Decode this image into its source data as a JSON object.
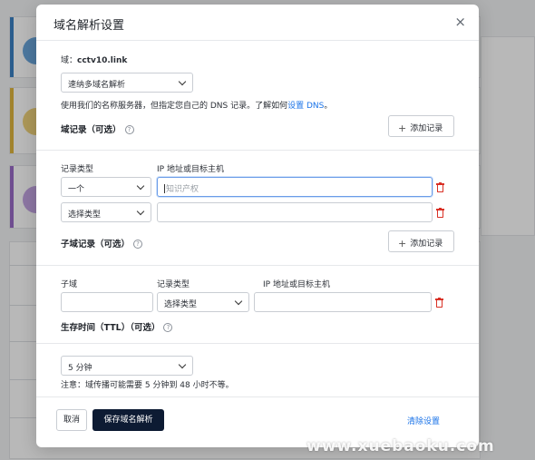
{
  "dialog": {
    "title": "域名解析设置",
    "close_symbol": "×",
    "domain_label": "域：",
    "domain_value": "cctv10.link",
    "resolver_select": "速纳多域名解析",
    "info_text": "使用我们的名称服务器，但指定您自己的 DNS 记录。了解如何",
    "info_link": "设置 DNS",
    "info_period": "。"
  },
  "domain_records": {
    "title": "域记录（可选）",
    "add_button": "添加记录",
    "col_type": "记录类型",
    "col_target": "IP 地址或目标主机",
    "rows": [
      {
        "type": "一个",
        "value": "",
        "placeholder": "知识产权"
      },
      {
        "type": "选择类型",
        "value": "",
        "placeholder": ""
      }
    ]
  },
  "subdomain_records": {
    "title": "子域记录（可选）",
    "add_button": "添加记录",
    "col_subdomain": "子域",
    "col_type": "记录类型",
    "col_target": "IP 地址或目标主机",
    "rows": [
      {
        "subdomain": "",
        "type": "选择类型",
        "value": ""
      }
    ]
  },
  "ttl": {
    "title": "生存时间（TTL）（可选）",
    "select": "5 分钟",
    "note": "注意：域传播可能需要 5 分钟到 48 小时不等。"
  },
  "footer": {
    "cancel": "取消",
    "save": "保存域名解析",
    "clear": "清除设置"
  },
  "watermark": "www.xuebaoku.com",
  "colors": {
    "primary_button": "#0d1b33",
    "link": "#1a73e8",
    "delete": "#d93025"
  }
}
